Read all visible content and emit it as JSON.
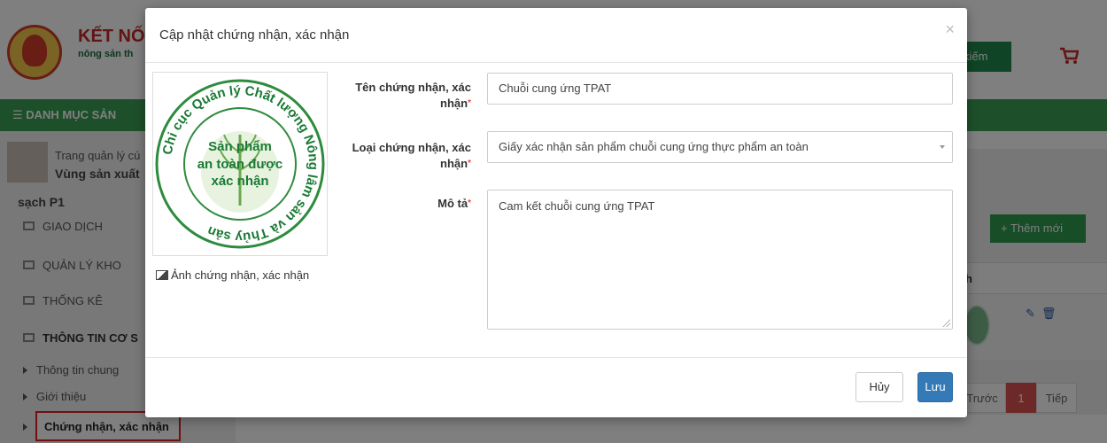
{
  "background": {
    "brand_title": "KẾT NỐI",
    "brand_sub": "nông sản th",
    "search_button": "kiếm",
    "nav_label": "☰ DANH MỤC SẢN",
    "user": {
      "line1": "Trang quản lý cú",
      "line2": "Vùng sản xuất",
      "line3": "sạch P1"
    },
    "menu": [
      {
        "icon": "grid-icon",
        "label": "GIAO DỊCH"
      },
      {
        "icon": "warehouse-icon",
        "label": "QUẢN LÝ KHO"
      },
      {
        "icon": "monitor-icon",
        "label": "THỐNG KÊ"
      },
      {
        "icon": "cogs-icon",
        "label": "THÔNG TIN CƠ S"
      }
    ],
    "submenu": [
      {
        "label": "Thông tin chung"
      },
      {
        "label": "Giới thiệu"
      },
      {
        "label": "Chứng nhận, xác nhận"
      }
    ],
    "add_button": "+ Thêm mới",
    "table_header": "h",
    "pagination": {
      "prev": "Trước",
      "current": "1",
      "next": "Tiếp"
    }
  },
  "modal": {
    "title": "Cập nhật chứng nhận, xác nhận",
    "close": "×",
    "certificate": {
      "ring_text": "Chi cục Quản lý Chất lượng Nông lâm sản và Thủy sản",
      "center_lines": [
        "Sản phẩm",
        "an toàn được",
        "xác nhận"
      ],
      "caption": "Ảnh chứng nhận, xác nhận"
    },
    "fields": {
      "name": {
        "label_line1": "Tên chứng nhận, xác",
        "label_line2": "nhận",
        "value": "Chuỗi cung ứng TPAT"
      },
      "type": {
        "label_line1": "Loại chứng nhận, xác",
        "label_line2": "nhận",
        "value": "Giấy xác nhận sản phẩm chuỗi cung ứng thực phẩm an toàn"
      },
      "description": {
        "label": "Mô tả",
        "value": "Cam kết chuỗi cung ứng TPAT"
      }
    },
    "required_mark": "*",
    "buttons": {
      "cancel": "Hủy",
      "save": "Lưu"
    }
  }
}
